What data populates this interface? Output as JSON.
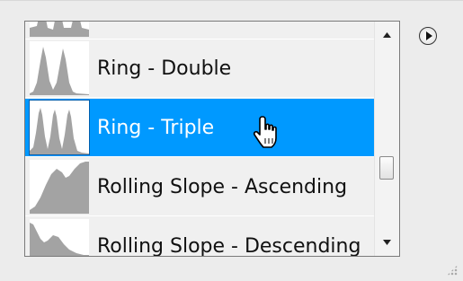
{
  "preset_list": {
    "items": [
      {
        "label": "",
        "icon": "partial-preset-thumbnail",
        "selected": false,
        "partial": true
      },
      {
        "label": "Ring - Double",
        "icon": "ring-double-thumbnail",
        "selected": false
      },
      {
        "label": "Ring - Triple",
        "icon": "ring-triple-thumbnail",
        "selected": true
      },
      {
        "label": "Rolling Slope - Ascending",
        "icon": "rolling-slope-ascending-thumbnail",
        "selected": false
      },
      {
        "label": "Rolling Slope - Descending",
        "icon": "rolling-slope-descending-thumbnail",
        "selected": false
      }
    ],
    "selection_color": "#0099ff",
    "thumbnail_fill": "#a3a3a3"
  },
  "scrollbar": {
    "up_icon": "scroll-up-arrow-icon",
    "down_icon": "scroll-down-arrow-icon",
    "position": 0.68
  },
  "panel_menu": {
    "icon": "panel-menu-play-icon"
  },
  "cursor": {
    "icon": "hand-pointer-icon"
  }
}
